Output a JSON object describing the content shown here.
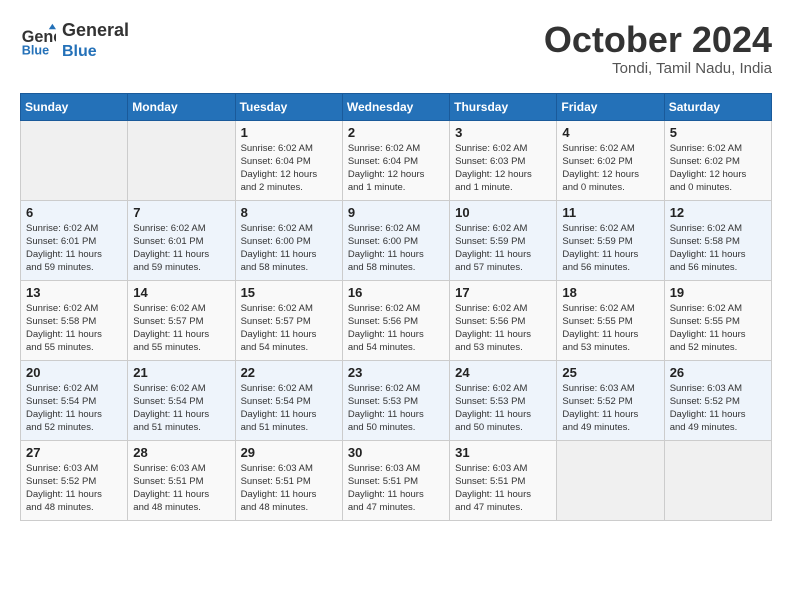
{
  "header": {
    "logo_line1": "General",
    "logo_line2": "Blue",
    "month_title": "October 2024",
    "subtitle": "Tondi, Tamil Nadu, India"
  },
  "days_of_week": [
    "Sunday",
    "Monday",
    "Tuesday",
    "Wednesday",
    "Thursday",
    "Friday",
    "Saturday"
  ],
  "weeks": [
    [
      {
        "day": "",
        "info": ""
      },
      {
        "day": "",
        "info": ""
      },
      {
        "day": "1",
        "info": "Sunrise: 6:02 AM\nSunset: 6:04 PM\nDaylight: 12 hours\nand 2 minutes."
      },
      {
        "day": "2",
        "info": "Sunrise: 6:02 AM\nSunset: 6:04 PM\nDaylight: 12 hours\nand 1 minute."
      },
      {
        "day": "3",
        "info": "Sunrise: 6:02 AM\nSunset: 6:03 PM\nDaylight: 12 hours\nand 1 minute."
      },
      {
        "day": "4",
        "info": "Sunrise: 6:02 AM\nSunset: 6:02 PM\nDaylight: 12 hours\nand 0 minutes."
      },
      {
        "day": "5",
        "info": "Sunrise: 6:02 AM\nSunset: 6:02 PM\nDaylight: 12 hours\nand 0 minutes."
      }
    ],
    [
      {
        "day": "6",
        "info": "Sunrise: 6:02 AM\nSunset: 6:01 PM\nDaylight: 11 hours\nand 59 minutes."
      },
      {
        "day": "7",
        "info": "Sunrise: 6:02 AM\nSunset: 6:01 PM\nDaylight: 11 hours\nand 59 minutes."
      },
      {
        "day": "8",
        "info": "Sunrise: 6:02 AM\nSunset: 6:00 PM\nDaylight: 11 hours\nand 58 minutes."
      },
      {
        "day": "9",
        "info": "Sunrise: 6:02 AM\nSunset: 6:00 PM\nDaylight: 11 hours\nand 58 minutes."
      },
      {
        "day": "10",
        "info": "Sunrise: 6:02 AM\nSunset: 5:59 PM\nDaylight: 11 hours\nand 57 minutes."
      },
      {
        "day": "11",
        "info": "Sunrise: 6:02 AM\nSunset: 5:59 PM\nDaylight: 11 hours\nand 56 minutes."
      },
      {
        "day": "12",
        "info": "Sunrise: 6:02 AM\nSunset: 5:58 PM\nDaylight: 11 hours\nand 56 minutes."
      }
    ],
    [
      {
        "day": "13",
        "info": "Sunrise: 6:02 AM\nSunset: 5:58 PM\nDaylight: 11 hours\nand 55 minutes."
      },
      {
        "day": "14",
        "info": "Sunrise: 6:02 AM\nSunset: 5:57 PM\nDaylight: 11 hours\nand 55 minutes."
      },
      {
        "day": "15",
        "info": "Sunrise: 6:02 AM\nSunset: 5:57 PM\nDaylight: 11 hours\nand 54 minutes."
      },
      {
        "day": "16",
        "info": "Sunrise: 6:02 AM\nSunset: 5:56 PM\nDaylight: 11 hours\nand 54 minutes."
      },
      {
        "day": "17",
        "info": "Sunrise: 6:02 AM\nSunset: 5:56 PM\nDaylight: 11 hours\nand 53 minutes."
      },
      {
        "day": "18",
        "info": "Sunrise: 6:02 AM\nSunset: 5:55 PM\nDaylight: 11 hours\nand 53 minutes."
      },
      {
        "day": "19",
        "info": "Sunrise: 6:02 AM\nSunset: 5:55 PM\nDaylight: 11 hours\nand 52 minutes."
      }
    ],
    [
      {
        "day": "20",
        "info": "Sunrise: 6:02 AM\nSunset: 5:54 PM\nDaylight: 11 hours\nand 52 minutes."
      },
      {
        "day": "21",
        "info": "Sunrise: 6:02 AM\nSunset: 5:54 PM\nDaylight: 11 hours\nand 51 minutes."
      },
      {
        "day": "22",
        "info": "Sunrise: 6:02 AM\nSunset: 5:54 PM\nDaylight: 11 hours\nand 51 minutes."
      },
      {
        "day": "23",
        "info": "Sunrise: 6:02 AM\nSunset: 5:53 PM\nDaylight: 11 hours\nand 50 minutes."
      },
      {
        "day": "24",
        "info": "Sunrise: 6:02 AM\nSunset: 5:53 PM\nDaylight: 11 hours\nand 50 minutes."
      },
      {
        "day": "25",
        "info": "Sunrise: 6:03 AM\nSunset: 5:52 PM\nDaylight: 11 hours\nand 49 minutes."
      },
      {
        "day": "26",
        "info": "Sunrise: 6:03 AM\nSunset: 5:52 PM\nDaylight: 11 hours\nand 49 minutes."
      }
    ],
    [
      {
        "day": "27",
        "info": "Sunrise: 6:03 AM\nSunset: 5:52 PM\nDaylight: 11 hours\nand 48 minutes."
      },
      {
        "day": "28",
        "info": "Sunrise: 6:03 AM\nSunset: 5:51 PM\nDaylight: 11 hours\nand 48 minutes."
      },
      {
        "day": "29",
        "info": "Sunrise: 6:03 AM\nSunset: 5:51 PM\nDaylight: 11 hours\nand 48 minutes."
      },
      {
        "day": "30",
        "info": "Sunrise: 6:03 AM\nSunset: 5:51 PM\nDaylight: 11 hours\nand 47 minutes."
      },
      {
        "day": "31",
        "info": "Sunrise: 6:03 AM\nSunset: 5:51 PM\nDaylight: 11 hours\nand 47 minutes."
      },
      {
        "day": "",
        "info": ""
      },
      {
        "day": "",
        "info": ""
      }
    ]
  ]
}
